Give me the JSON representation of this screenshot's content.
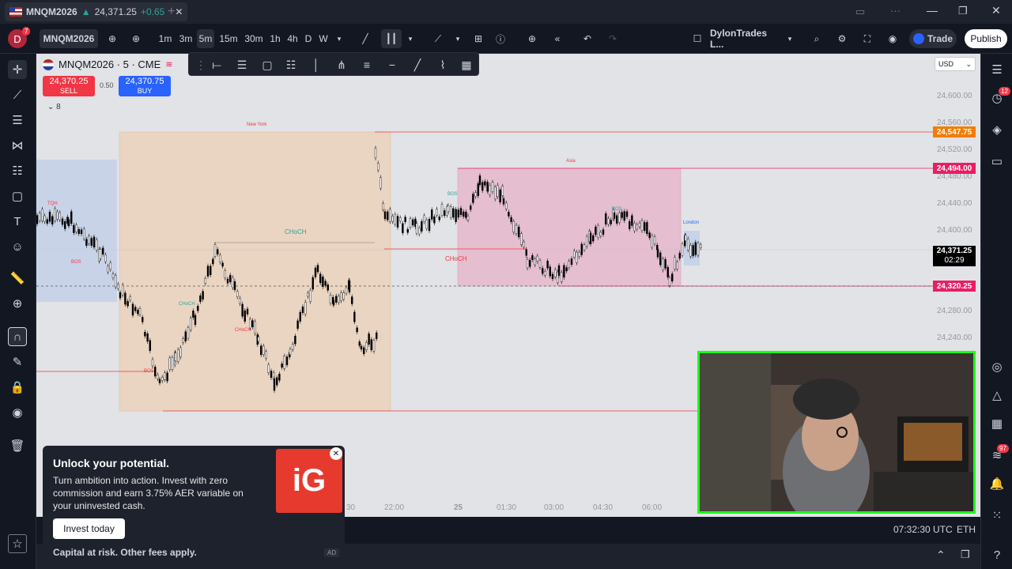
{
  "tab": {
    "symbol": "MNQM2026",
    "arrow": "▲",
    "price": "24,371.25",
    "change": "+0.65"
  },
  "toolbar": {
    "avatar_letter": "D",
    "avatar_badge": "7",
    "symbol": "MNQM2026",
    "intervals": [
      "1m",
      "3m",
      "5m",
      "15m",
      "30m",
      "1h",
      "4h",
      "D",
      "W"
    ],
    "active_interval": "5m",
    "layout_name": "DylonTrades L...",
    "trade_label": "Trade",
    "publish_label": "Publish"
  },
  "legend": {
    "title": "MNQM2026 · 5 · CME",
    "sell_price": "24,370.25",
    "sell_label": "SELL",
    "spread": "0.50",
    "buy_price": "24,370.75",
    "buy_label": "BUY",
    "indicator_count": "8"
  },
  "price_scale": {
    "currency": "USD",
    "ticks": [
      "24,600.00",
      "24,560.00",
      "24,520.00",
      "24,480.00",
      "24,440.00",
      "24,400.00",
      "24,360.00",
      "24,320.00",
      "24,280.00",
      "24,240.00"
    ],
    "label_high": "24,547.75",
    "label_mid": "24,494.00",
    "label_current": "24,371.25",
    "label_countdown": "02:29",
    "label_low": "24,320.25"
  },
  "chart_annotations": {
    "session_ny": "New York",
    "session_asia": "Asia",
    "session_london": "London",
    "choch_1": "CHoCH",
    "choch_2": "CHoCH",
    "choch_3": "CHoCH",
    "choch_4": "CHoCH",
    "bos_1": "BOS",
    "bos_2": "BOS",
    "bos_3": "BOS",
    "bos_4": "BOS",
    "tqh": "TQH"
  },
  "time_axis": [
    "30",
    "22:00",
    "25",
    "01:30",
    "03:00",
    "04:30",
    "06:00"
  ],
  "bottom": {
    "time": "07:32:30 UTC",
    "session": "ETH"
  },
  "right_badges": {
    "alerts": "12",
    "notifications": "97"
  },
  "ad": {
    "title": "Unlock your potential.",
    "body": "Turn ambition into action. Invest with zero commission and earn 3.75% AER variable on your uninvested cash.",
    "cta": "Invest today",
    "disclaimer": "Capital at risk. Other fees apply.",
    "ad_badge": "AD",
    "logo": "iG"
  },
  "colors": {
    "up": "#26a69a",
    "down": "#f23645",
    "accent": "#2962ff",
    "ny_box": "#f3c9a6",
    "asia_box": "#e9a6c2",
    "london_box": "#b7c6ea"
  }
}
